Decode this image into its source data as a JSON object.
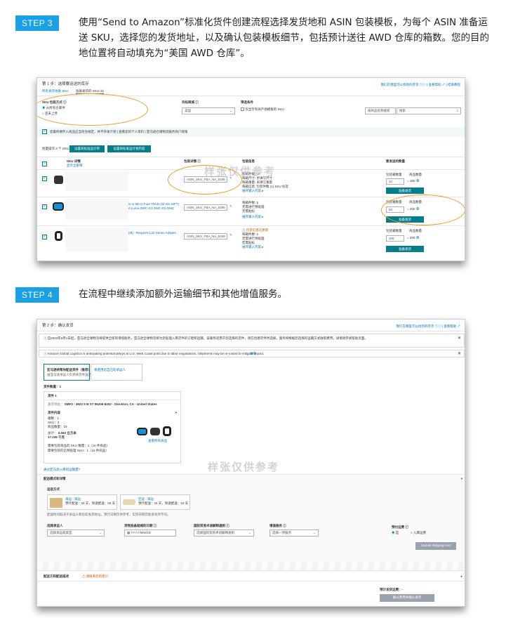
{
  "step3": {
    "badge": "STEP 3",
    "text": "使用“Send to Amazon”标准化货件创建流程选择发货地和 ASIN 包装模板，为每个 ASIN 准备运送 SKU，选择您的发货地址，以及确认包装模板细节，包括预计送往 AWD 仓库的箱数。您的目的地位置将自动填充为“美国 AWD 仓库”。",
    "screenshot": {
      "title": "第 1 步：选择要运送的库存",
      "tabs": [
        "所有发货地类 SKU",
        "准备发货的 SKU (3)"
      ],
      "top_right": "我们在哪里可以找到的存货 ◎◎  |  查看帮助 ↗  |  结束教程",
      "sku_label": "SKU 包装方式 ⓘ",
      "radio1": "从所有仓库件",
      "radio2": "还未上传",
      "marketplace_label": "目标商城 ⓘ",
      "marketplace_value": "美国",
      "template_label": "筛选条件",
      "template_check": "仅显示有效产地模板的 SKU",
      "search_select": "按商品名称搜索",
      "search_placeholder": "搜索",
      "info_check": "您最终要存入商品应当符合规定，并不开发计划 | 查看您的个人资料 | 亚马逊仓储物流服务商户政策",
      "count_label": "批量操作 3 个 SKU",
      "bulk_btn1": "设置商标准运计单",
      "bulk_btn2": "设置商标发运计划内容",
      "col_sku": "SKU 详情",
      "col_sku_sub": "显示全部筛",
      "col_pack": "包装详情 ⓘ",
      "col_info": "包装信息",
      "col_qty": "要发送的数量",
      "rows": [
        {
          "desc": "",
          "template": "ASIN_SKU_FBA_NA_5336",
          "info": [
            "每箱件数: 10",
            "每箱尺寸: 手填写尺寸",
            "每箱重量: 未填写重量",
            "每箱信息: 包装件数 (1) SKU 标签"
          ],
          "link": "展开输入内容 ▸",
          "box_label": "包装箱数量",
          "unit_label": "商品数量",
          "boxes": "10",
          "units": "100",
          "btn": "准备发货"
        },
        {
          "desc": "is to Micro Four Thirds (M 4/3, MFT) d Lumix DMC-G1 DMC-G5 DMC",
          "template": "ASIN_SKU_FBA_NA_5296",
          "info": [
            "每箱件数: 5",
            "无需进行预处理",
            "无需贴标"
          ],
          "link": "展开输入内容 ▸",
          "box_label": "包装箱数量",
          "unit_label": "商品数量",
          "boxes": "50",
          "units": "250",
          "btn": "准备发货"
        },
        {
          "desc": "(M) - Requires L22 Series Adapter",
          "template": "ASIN_SKU_FBA_NA_5299",
          "info": [
            "⚠ 包装信息已更新",
            "每箱件数: 2",
            "无需进行预处理",
            "无需贴标"
          ],
          "link": "展开输入内容 ▸",
          "box_label": "包装箱数量",
          "unit_label": "商品数量",
          "boxes": "100",
          "units": "200",
          "btn": "准备发货"
        }
      ]
    }
  },
  "step4": {
    "badge": "STEP 4",
    "text": "在流程中继续添加额外运输细节和其他增值服务。",
    "screenshot": {
      "title": "第 2 步：确认发货",
      "top_right": "我们在哪里可以找到的存货 ◎◎  |  查看帮助 ↗",
      "notice1": "ⓘ  自2022年8月1日起，亚马逊全球物流将提供全新的增值服务，亚马逊全球物流将为您处理入库货件的订舱和运输，该服务适用于您选择的货件，请在创建货件时选择。服务将根据您选择的运输方式收取费用，详情请参阅帮助页面。",
      "notice1_link": "了解更多",
      "notice2": "ⓘ  Amazon Global Logistics is anticipating potential delays at U.S. West Coast ports due to labor negotiations. Shipments may be re-routed to mitigate impact.",
      "notice2_link": "详情",
      "tab_active": "亚马逊将帮你配送货件（推荐）",
      "tab_active_sub": "由亚马逊承运人负责将货件送达",
      "tab_inactive": "将使用您自己的承运人",
      "shipment_count": "货件数量：1",
      "shipment_label": "货件 1",
      "ship_from_label": "发货地址：",
      "ship_from": "SMF3 - 3923 S B ST 95206-8202 - Stockton, CA - United States",
      "contents_label": "货件内容",
      "contents": [
        "箱数：1",
        "SKU：3",
        "商品数量：19"
      ],
      "weight_label": "总计：",
      "weight": "0.063 立方米",
      "weight2": "17.236 千克",
      "total_sku": "需要包装商品的 SKU 数量：1（16 件商品）",
      "total_label": "需要包装的已预处理 SKU：1（16 件商品）",
      "view_link": "查看所有商品",
      "add_link": "通过亚马逊入库的运输量?",
      "section_mode": "配送模式和详情",
      "ship_method_label": "运送方式",
      "method1_title": "海运 - 海运",
      "method1_detail": "预计配送：34 天，快速配送：26 天",
      "method2_title": "空运 - 海运",
      "method2_detail": "预计配送：34 天，快速配送：34 天",
      "method_note": "配送时间取决于承运人和您的发货地址。预计日期仅供参考，实际日期可能会有所不同。",
      "f1_label": "选择承运人",
      "f1_value": "选择承运商类型",
      "f2_label": "货物准备就绪的日期 ⓘ",
      "f2_value": "YYYY/MM/DD",
      "f3_label": "国际贸易术语解释通则 ⓘ",
      "f3_value": "选择国际贸易术语解释通则",
      "f4_label": "增值服务 ⓘ",
      "f4_value": "选择一项服务",
      "radio_label": "预付运费 ⓘ",
      "radio1": "是",
      "radio2": "入库运费",
      "update_btn": "Update shipping cost",
      "section_fee": "配送方和配送描述",
      "fee_warn": "⚠ 请联系您的客户",
      "est_label": "预计发货运费：-",
      "confirm_btn": "确认费用并确认发货"
    }
  },
  "watermark": "样张仅供参考"
}
